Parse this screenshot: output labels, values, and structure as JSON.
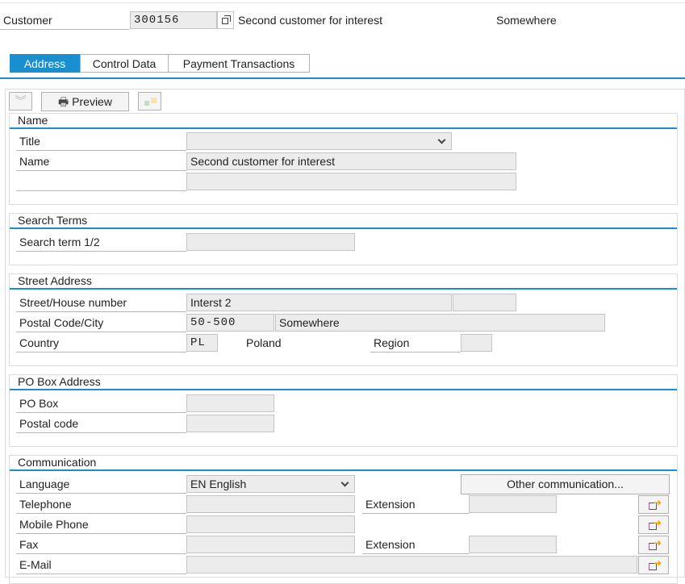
{
  "header": {
    "customer_label": "Customer",
    "customer_number": "300156",
    "customer_name": "Second customer for interest",
    "city": "Somewhere"
  },
  "tabs": [
    {
      "label": "Address",
      "active": true
    },
    {
      "label": "Control Data"
    },
    {
      "label": "Payment Transactions"
    }
  ],
  "toolbar": {
    "preview_label": "Preview"
  },
  "name_section": {
    "title": "Name",
    "title_label": "Title",
    "title_value": "",
    "name_label": "Name",
    "name_value": "Second customer for interest",
    "name2_value": ""
  },
  "search_section": {
    "title": "Search Terms",
    "search_label": "Search term 1/2",
    "search_value": ""
  },
  "street_section": {
    "title": "Street Address",
    "street_label": "Street/House number",
    "street_value": "Interst 2",
    "house_value": "",
    "postal_label": "Postal Code/City",
    "postal_value": "50-500",
    "city_value": "Somewhere",
    "country_label": "Country",
    "country_code": "PL",
    "country_name": "Poland",
    "region_label": "Region",
    "region_value": ""
  },
  "pobox_section": {
    "title": "PO Box Address",
    "pobox_label": "PO Box",
    "pobox_value": "",
    "postal_label": "Postal code",
    "postal_value": ""
  },
  "comm_section": {
    "title": "Communication",
    "language_label": "Language",
    "language_value": "EN English",
    "other_button": "Other communication...",
    "telephone_label": "Telephone",
    "extension_label": "Extension",
    "mobile_label": "Mobile Phone",
    "fax_label": "Fax",
    "fax_extension_label": "Extension",
    "email_label": "E-Mail"
  },
  "colors": {
    "accent": "#1a8fd0",
    "field_bg": "#ececec"
  }
}
